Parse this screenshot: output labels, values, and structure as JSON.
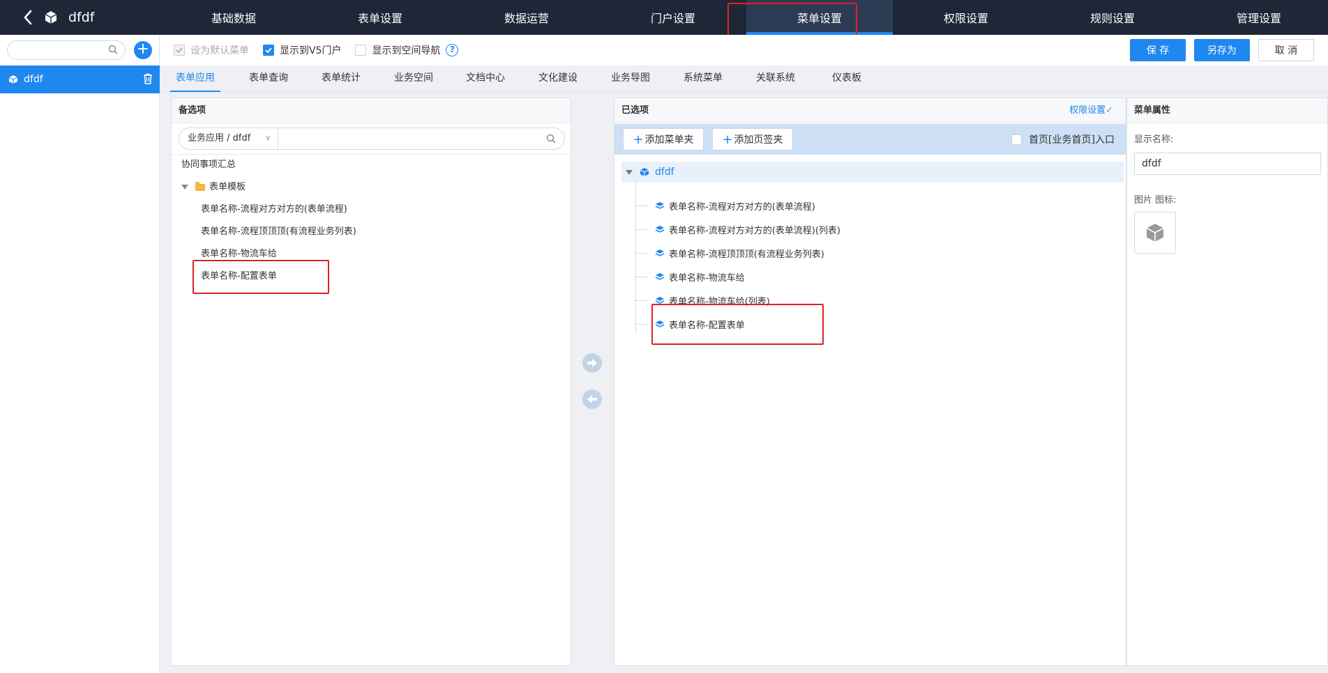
{
  "app": {
    "title": "dfdf",
    "back_icon": "chevron-left-icon",
    "logo_icon": "cube-icon"
  },
  "nav": {
    "items": [
      {
        "label": "基础数据"
      },
      {
        "label": "表单设置"
      },
      {
        "label": "数据运营"
      },
      {
        "label": "门户设置"
      },
      {
        "label": "菜单设置",
        "active": true
      },
      {
        "label": "权限设置"
      },
      {
        "label": "规则设置"
      },
      {
        "label": "管理设置"
      }
    ]
  },
  "sidebar": {
    "search": {
      "placeholder": "",
      "value": ""
    },
    "add_icon": "plus-icon",
    "items": [
      {
        "label": "dfdf",
        "selected": true,
        "delete_icon": "trash-icon"
      }
    ]
  },
  "toolbar": {
    "checkboxes": [
      {
        "label": "设为默认菜单",
        "checked": true,
        "disabled": true
      },
      {
        "label": "显示到V5门户",
        "checked": true,
        "disabled": false
      },
      {
        "label": "显示到空间导航",
        "checked": false,
        "disabled": false
      }
    ],
    "help_label": "?",
    "save_label": "保 存",
    "save_as_label": "另存为",
    "cancel_label": "取 消"
  },
  "tabs": [
    {
      "label": "表单应用",
      "active": true
    },
    {
      "label": "表单查询"
    },
    {
      "label": "表单统计"
    },
    {
      "label": "业务空间"
    },
    {
      "label": "文档中心"
    },
    {
      "label": "文化建设"
    },
    {
      "label": "业务导图"
    },
    {
      "label": "系统菜单"
    },
    {
      "label": "关联系统"
    },
    {
      "label": "仪表板"
    }
  ],
  "candidates": {
    "title": "备选项",
    "filter": {
      "select_value": "业务应用 / dfdf",
      "search_value": "",
      "search_placeholder": ""
    },
    "items": [
      {
        "label": "协同事项汇总",
        "level": 0
      },
      {
        "label": "表单模板",
        "level": 0,
        "folder": true,
        "expanded": true
      },
      {
        "label": "表单名称-流程对方对方的(表单流程)",
        "level": 1
      },
      {
        "label": "表单名称-流程顶顶顶(有流程业务列表)",
        "level": 1
      },
      {
        "label": "表单名称-物流车给",
        "level": 1
      },
      {
        "label": "表单名称-配置表单",
        "level": 1,
        "highlighted": true
      }
    ]
  },
  "transfer": {
    "add_icon": "arrow-right-icon",
    "remove_icon": "arrow-left-icon"
  },
  "selected": {
    "title": "已选项",
    "permission_link": "权限设置",
    "add_folder_label": "添加菜单夹",
    "add_tab_label": "添加页签夹",
    "home_entry_label": "首页[业务首页]入口",
    "home_entry_checked": false,
    "root": {
      "label": "dfdf"
    },
    "children": [
      {
        "label": "表单名称-流程对方对方的(表单流程)"
      },
      {
        "label": "表单名称-流程对方对方的(表单流程)(列表)"
      },
      {
        "label": "表单名称-流程顶顶顶(有流程业务列表)"
      },
      {
        "label": "表单名称-物流车给"
      },
      {
        "label": "表单名称-物流车给(列表)"
      },
      {
        "label": "表单名称-配置表单",
        "highlighted": true
      }
    ]
  },
  "properties": {
    "title": "菜单属性",
    "display_name_label": "显示名称:",
    "display_name_value": "dfdf",
    "image_icon_label": "图片 图标:",
    "icon": "cube-icon"
  },
  "colors": {
    "accent": "#1e87f0",
    "topbar": "#1d2737",
    "highlight": "#e02020"
  }
}
